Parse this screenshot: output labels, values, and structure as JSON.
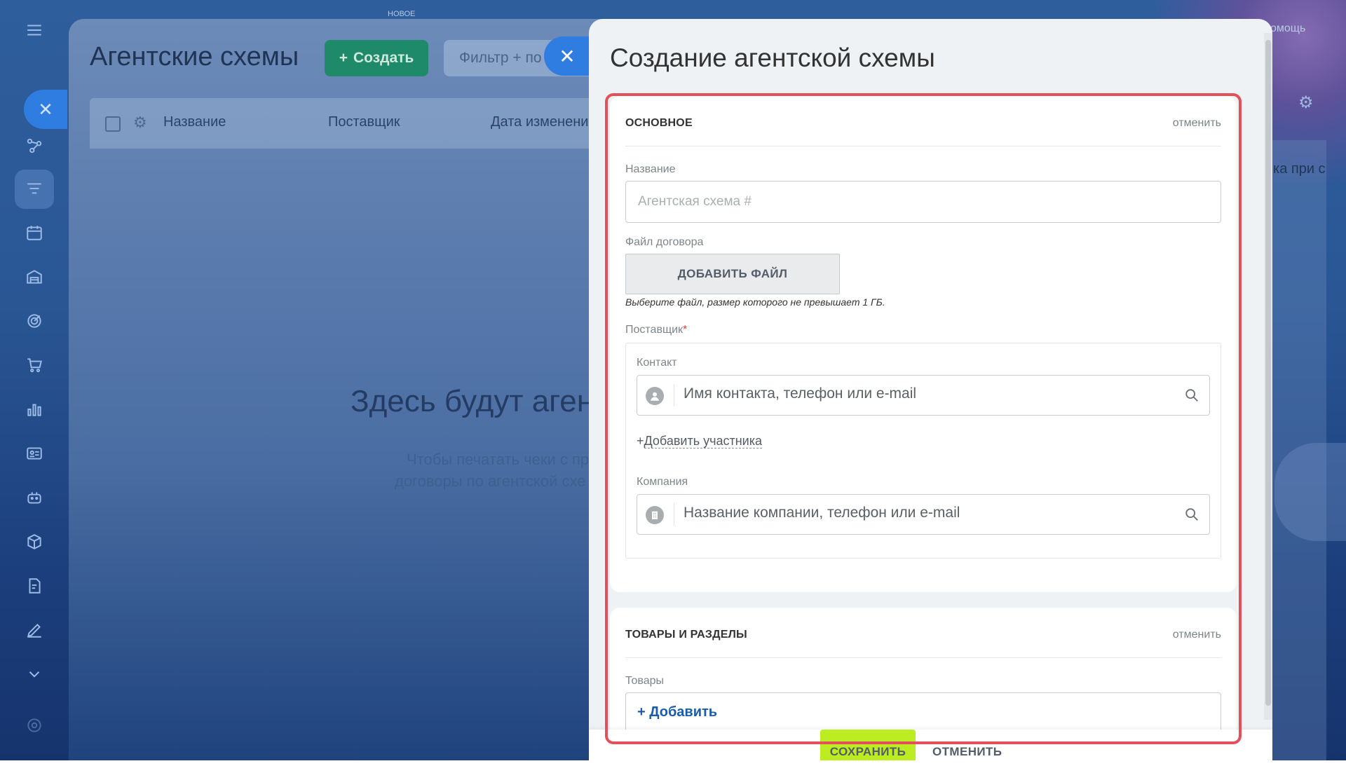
{
  "background": {
    "new_badge": "НОВОЕ",
    "title": "Агентские схемы",
    "create_button": "Создать",
    "filter_placeholder": "Фильтр + по",
    "columns": [
      "Название",
      "Поставщик",
      "Дата изменени"
    ],
    "empty_title": "Здесь будут агент",
    "empty_line1": "Чтобы печатать чеки с пр",
    "empty_line2": "договоры по агентской схе",
    "help_label": "омощь",
    "right_text": "ка при с"
  },
  "slider": {
    "title": "Создание агентской схемы",
    "main_section": {
      "header": "ОСНОВНОЕ",
      "cancel_label": "отменить",
      "name_label": "Название",
      "name_placeholder": "Агентская схема #",
      "file_label": "Файл договора",
      "add_file_button": "ДОБАВИТЬ ФАЙЛ",
      "file_hint": "Выберите файл, размер которого не превышает 1 ГБ.",
      "supplier_label": "Поставщик",
      "required_mark": "*",
      "contact_label": "Контакт",
      "contact_placeholder": "Имя контакта, телефон или e-mail",
      "add_participant": "Добавить участника",
      "add_participant_prefix": "+",
      "company_label": "Компания",
      "company_placeholder": "Название компании, телефон или e-mail"
    },
    "goods_section": {
      "header": "ТОВАРЫ И РАЗДЕЛЫ",
      "cancel_label": "отменить",
      "goods_label": "Товары",
      "add_label": "+ Добавить"
    },
    "footer": {
      "save_button": "СОХРАНИТЬ",
      "cancel_button": "ОТМЕНИТЬ"
    }
  },
  "colors": {
    "save_accent": "#bbed21",
    "highlight": "#e4505a",
    "close_button": "#2f7de1",
    "create_button": "#1f8a6a"
  }
}
